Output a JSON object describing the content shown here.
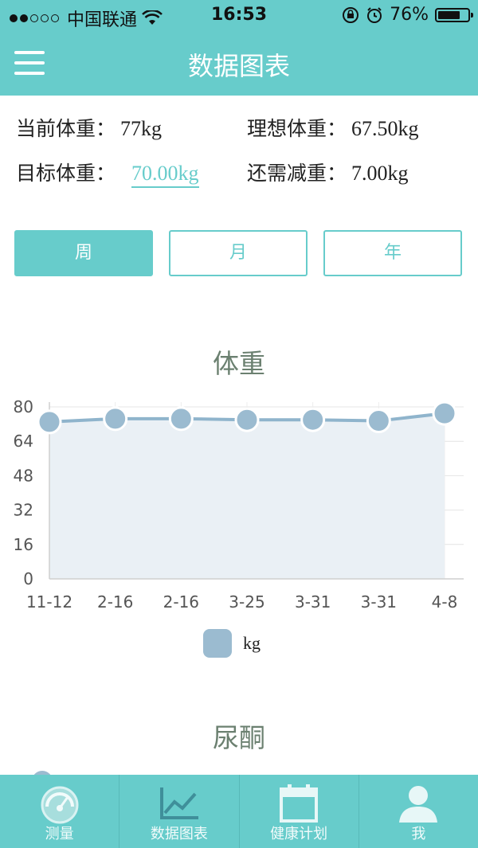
{
  "status_bar": {
    "carrier": "中国联通",
    "time": "16:53",
    "battery": "76%",
    "battery_level": 0.76
  },
  "nav": {
    "title": "数据图表",
    "menu_icon": "hamburger-menu-icon"
  },
  "info": {
    "current_weight_label": "当前体重：",
    "current_weight_value": "77kg",
    "ideal_weight_label": "理想体重：",
    "ideal_weight_value": "67.50kg",
    "target_weight_label": "目标体重：",
    "target_weight_value": "70.00kg",
    "remaining_label": "还需减重：",
    "remaining_value": "7.00kg"
  },
  "segments": [
    {
      "label": "周",
      "active": true
    },
    {
      "label": "月",
      "active": false
    },
    {
      "label": "年",
      "active": false
    }
  ],
  "weight_section": {
    "title": "体重"
  },
  "next_section": {
    "title": "尿酮"
  },
  "chart_data": {
    "type": "area",
    "title": "体重",
    "categories": [
      "11-12",
      "2-16",
      "2-16",
      "3-25",
      "3-31",
      "3-31",
      "4-8"
    ],
    "series": [
      {
        "name": "kg",
        "values": [
          73,
          74.5,
          74.5,
          74,
          74,
          73.5,
          77
        ]
      }
    ],
    "ylim": [
      0,
      80
    ],
    "yticks": [
      0,
      16,
      32,
      48,
      64,
      80
    ],
    "grid": true,
    "legend": "bottom-center",
    "colors": {
      "line": "#8fb4cc",
      "fill": "#eaf0f5",
      "point": "#9bbbd0"
    }
  },
  "tabs": [
    {
      "label": "测量",
      "icon": "speedometer-icon"
    },
    {
      "label": "数据图表",
      "icon": "line-chart-icon"
    },
    {
      "label": "健康计划",
      "icon": "calendar-icon"
    },
    {
      "label": "我",
      "icon": "user-icon"
    }
  ],
  "colors": {
    "accent": "#67cccb",
    "title_green": "#6b8070"
  }
}
